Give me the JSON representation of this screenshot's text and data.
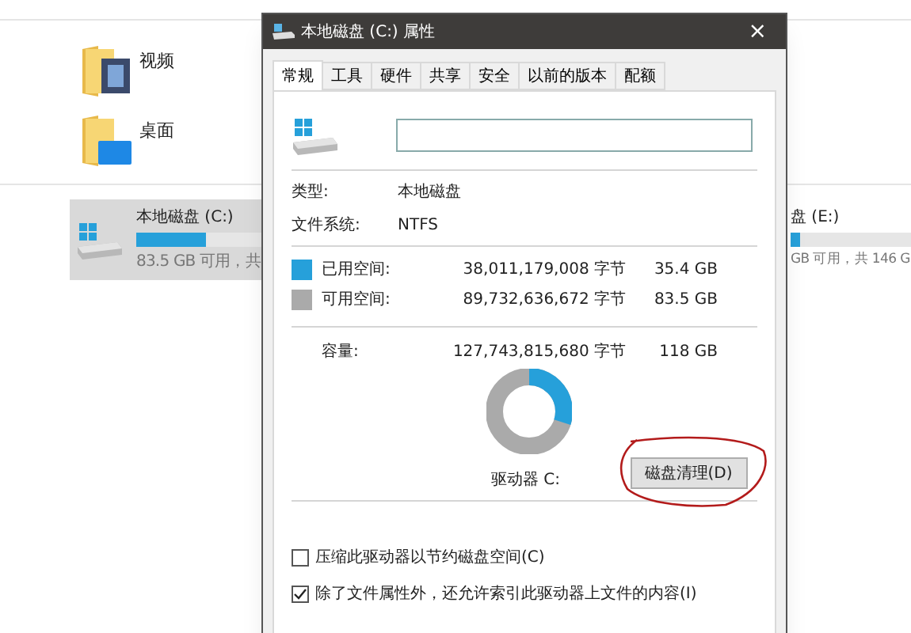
{
  "explorer": {
    "folders": [
      {
        "name": "视频",
        "kind": "video"
      },
      {
        "name": "桌面",
        "kind": "desktop"
      }
    ],
    "drives": [
      {
        "name": "本地磁盘 (C:)",
        "level": 0.3,
        "free": "83.5 GB 可用，共",
        "selected": true,
        "kind": "full"
      },
      {
        "name": "盘 (E:)",
        "level": 0.04,
        "free": "GB 可用，共 146 G",
        "selected": false,
        "kind": "partial"
      }
    ]
  },
  "dialog": {
    "title": "本地磁盘 (C:) 属性",
    "close": "×",
    "tabs": [
      {
        "label": "常规",
        "selected": true
      },
      {
        "label": "工具",
        "selected": false
      },
      {
        "label": "硬件",
        "selected": false
      },
      {
        "label": "共享",
        "selected": false
      },
      {
        "label": "安全",
        "selected": false
      },
      {
        "label": "以前的版本",
        "selected": false
      },
      {
        "label": "配额",
        "selected": false
      }
    ],
    "info": [
      {
        "label": "类型:",
        "value": "本地磁盘"
      },
      {
        "label": "文件系统:",
        "value": "NTFS"
      }
    ],
    "space": [
      {
        "label": "已用空间:",
        "bytes": "38,011,179,008 字节",
        "size": "35.4 GB",
        "color": "#26a0da"
      },
      {
        "label": "可用空间:",
        "bytes": "89,732,636,672 字节",
        "size": "83.5 GB",
        "color": "#aaaaaa"
      }
    ],
    "capacity": {
      "label": "容量:",
      "bytes": "127,743,815,680 字节",
      "size": "118 GB"
    },
    "usage": {
      "level": 0.3
    },
    "drive_label": "驱动器 C:",
    "cleanup_button": "磁盘清理(D)",
    "options": [
      {
        "label": "压缩此驱动器以节约磁盘空间(C)",
        "checked": false
      },
      {
        "label": "除了文件属性外，还允许索引此驱动器上文件的内容(I)",
        "checked": true
      }
    ]
  }
}
